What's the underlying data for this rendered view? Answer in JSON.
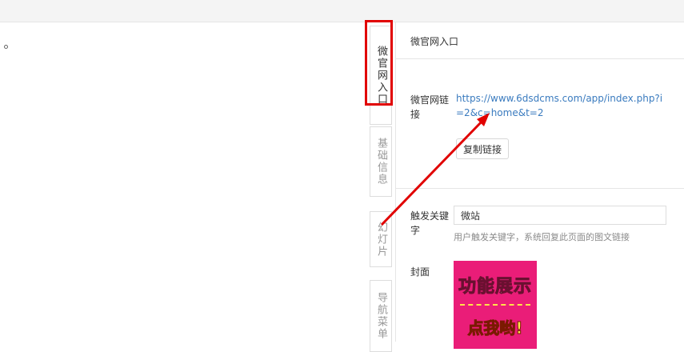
{
  "tabs": [
    {
      "label": "微官网入口",
      "active": true
    },
    {
      "label": "基础信息",
      "active": false
    },
    {
      "label": "幻灯片",
      "active": false
    },
    {
      "label": "导航菜单",
      "active": false
    }
  ],
  "panel": {
    "title": "微官网入口",
    "link_label": "微官网链接",
    "link_url": "https://www.6dsdcms.com/app/index.php?i=2&c=home&t=2",
    "copy_button": "复制链接",
    "keyword_label": "触发关键字",
    "keyword_value": "微站",
    "keyword_help": "用户触发关键字，系统回复此页面的图文链接",
    "cover_label": "封面",
    "cover_line1": "功能展示",
    "cover_line2": "点我哟!"
  },
  "colors": {
    "annotation_red": "#e10000",
    "link_blue": "#3a7bbf",
    "cover_pink": "#ea1d78",
    "cover_yellow": "#ffe34a"
  }
}
